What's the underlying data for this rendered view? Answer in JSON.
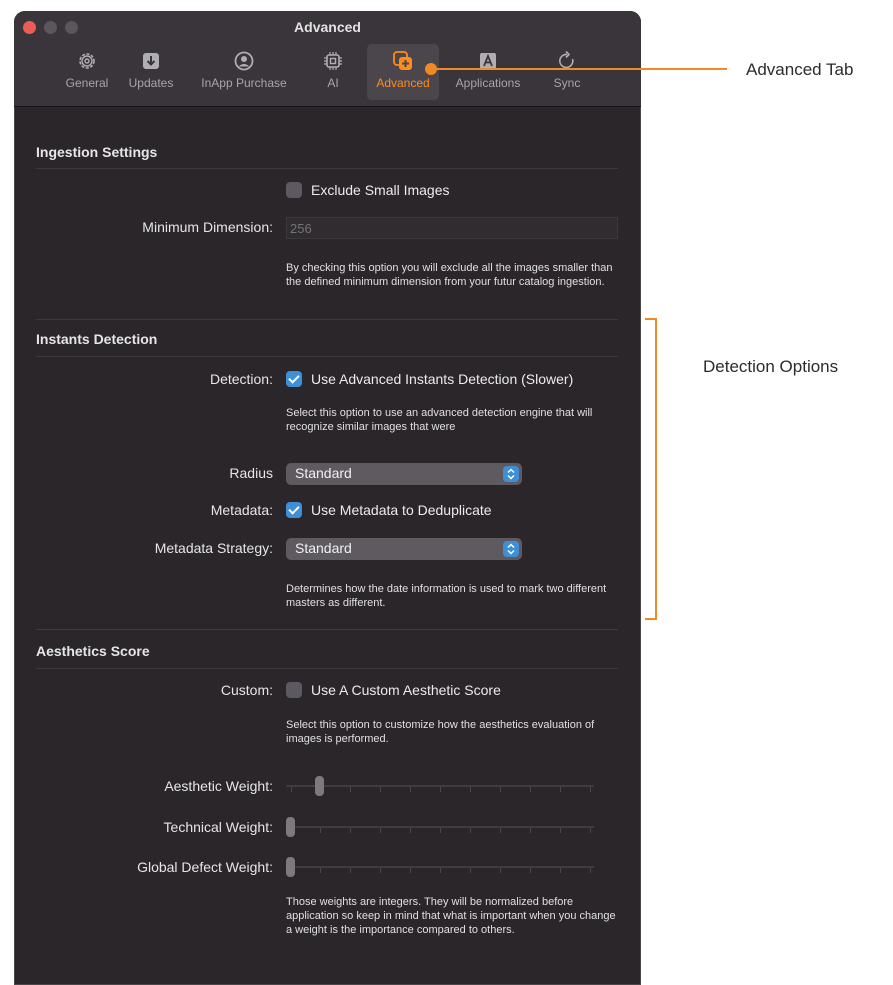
{
  "window": {
    "title": "Advanced",
    "tabs": [
      {
        "label": "General",
        "icon": "gear-icon",
        "active": false
      },
      {
        "label": "Updates",
        "icon": "download-icon",
        "active": false
      },
      {
        "label": "InApp Purchase",
        "icon": "person-circle-icon",
        "active": false
      },
      {
        "label": "AI",
        "icon": "chip-icon",
        "active": false
      },
      {
        "label": "Advanced",
        "icon": "advanced-icon",
        "active": true
      },
      {
        "label": "Applications",
        "icon": "app-a-icon",
        "active": false
      },
      {
        "label": "Sync",
        "icon": "sync-icon",
        "active": false
      }
    ]
  },
  "ingestion": {
    "title": "Ingestion Settings",
    "exclude_label": "Exclude Small Images",
    "exclude_checked": false,
    "min_dimension_label": "Minimum Dimension:",
    "min_dimension_placeholder": "256",
    "help": "By checking this option you will exclude all the images smaller than the defined minimum dimension from your futur catalog ingestion."
  },
  "instants": {
    "title": "Instants Detection",
    "detection_label": "Detection:",
    "detection_checkbox": "Use Advanced Instants Detection (Slower)",
    "detection_checked": true,
    "detection_help": "Select this option to use an advanced detection engine that will recognize similar images that were",
    "radius_label": "Radius",
    "radius_value": "Standard",
    "metadata_label": "Metadata:",
    "metadata_checkbox": "Use Metadata to Deduplicate",
    "metadata_checked": true,
    "strategy_label": "Metadata Strategy:",
    "strategy_value": "Standard",
    "strategy_help": "Determines how the date information is used to mark two different masters as different."
  },
  "aesthetics": {
    "title": "Aesthetics Score",
    "custom_label": "Custom:",
    "custom_checkbox": "Use A Custom Aesthetic Score",
    "custom_checked": false,
    "custom_help": "Select this option to customize how the aesthetics evaluation of images is performed.",
    "sliders": [
      {
        "label": "Aesthetic Weight:",
        "value": 1,
        "max": 10
      },
      {
        "label": "Technical Weight:",
        "value": 0,
        "max": 10
      },
      {
        "label": "Global Defect Weight:",
        "value": 0,
        "max": 10
      }
    ],
    "weights_help": "Those weights are integers. They will be normalized before application so keep in mind that what is important when you change a weight is the importance compared to others."
  },
  "annotations": {
    "advanced_tab": "Advanced Tab",
    "detection_options": "Detection Options",
    "accent_color": "#f08a24"
  }
}
